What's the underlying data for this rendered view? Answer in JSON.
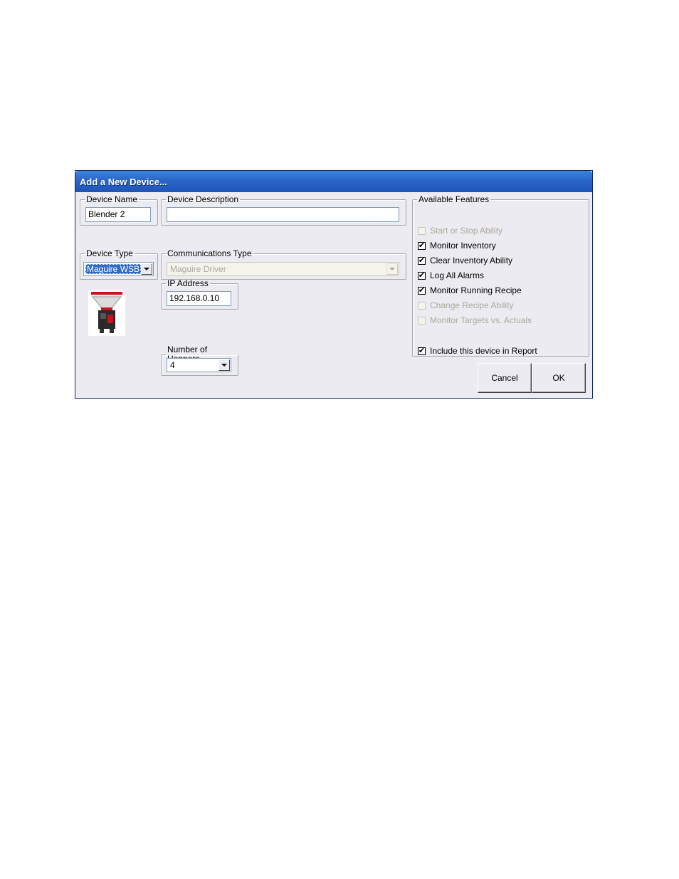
{
  "dialog": {
    "title": "Add a New Device..."
  },
  "device_name": {
    "label": "Device Name",
    "value": "Blender 2"
  },
  "device_description": {
    "label": "Device Description",
    "value": ""
  },
  "device_type": {
    "label": "Device Type",
    "value": "Maguire WSB"
  },
  "communications_type": {
    "label": "Communications Type",
    "value": "Maguire Driver"
  },
  "ip_address": {
    "label": "IP Address",
    "value": "192.168.0.10"
  },
  "number_of_hoppers": {
    "label": "Number of Hoppers",
    "value": "4"
  },
  "features": {
    "label": "Available Features",
    "items": [
      {
        "label": "Start or Stop Ability",
        "checked": false,
        "enabled": false
      },
      {
        "label": "Monitor Inventory",
        "checked": true,
        "enabled": true
      },
      {
        "label": "Clear Inventory Ability",
        "checked": true,
        "enabled": true
      },
      {
        "label": "Log All Alarms",
        "checked": true,
        "enabled": true
      },
      {
        "label": "Monitor Running Recipe",
        "checked": true,
        "enabled": true
      },
      {
        "label": "Change Recipe Ability",
        "checked": false,
        "enabled": false
      },
      {
        "label": "Monitor Targets vs. Actuals",
        "checked": false,
        "enabled": false
      }
    ],
    "include_report": {
      "label": "Include this device in Report",
      "checked": true
    }
  },
  "buttons": {
    "cancel": "Cancel",
    "ok": "OK"
  },
  "colors": {
    "titlebar": "#2a66c8",
    "dialog_bg": "#ecebf1",
    "selection": "#316ac5"
  }
}
